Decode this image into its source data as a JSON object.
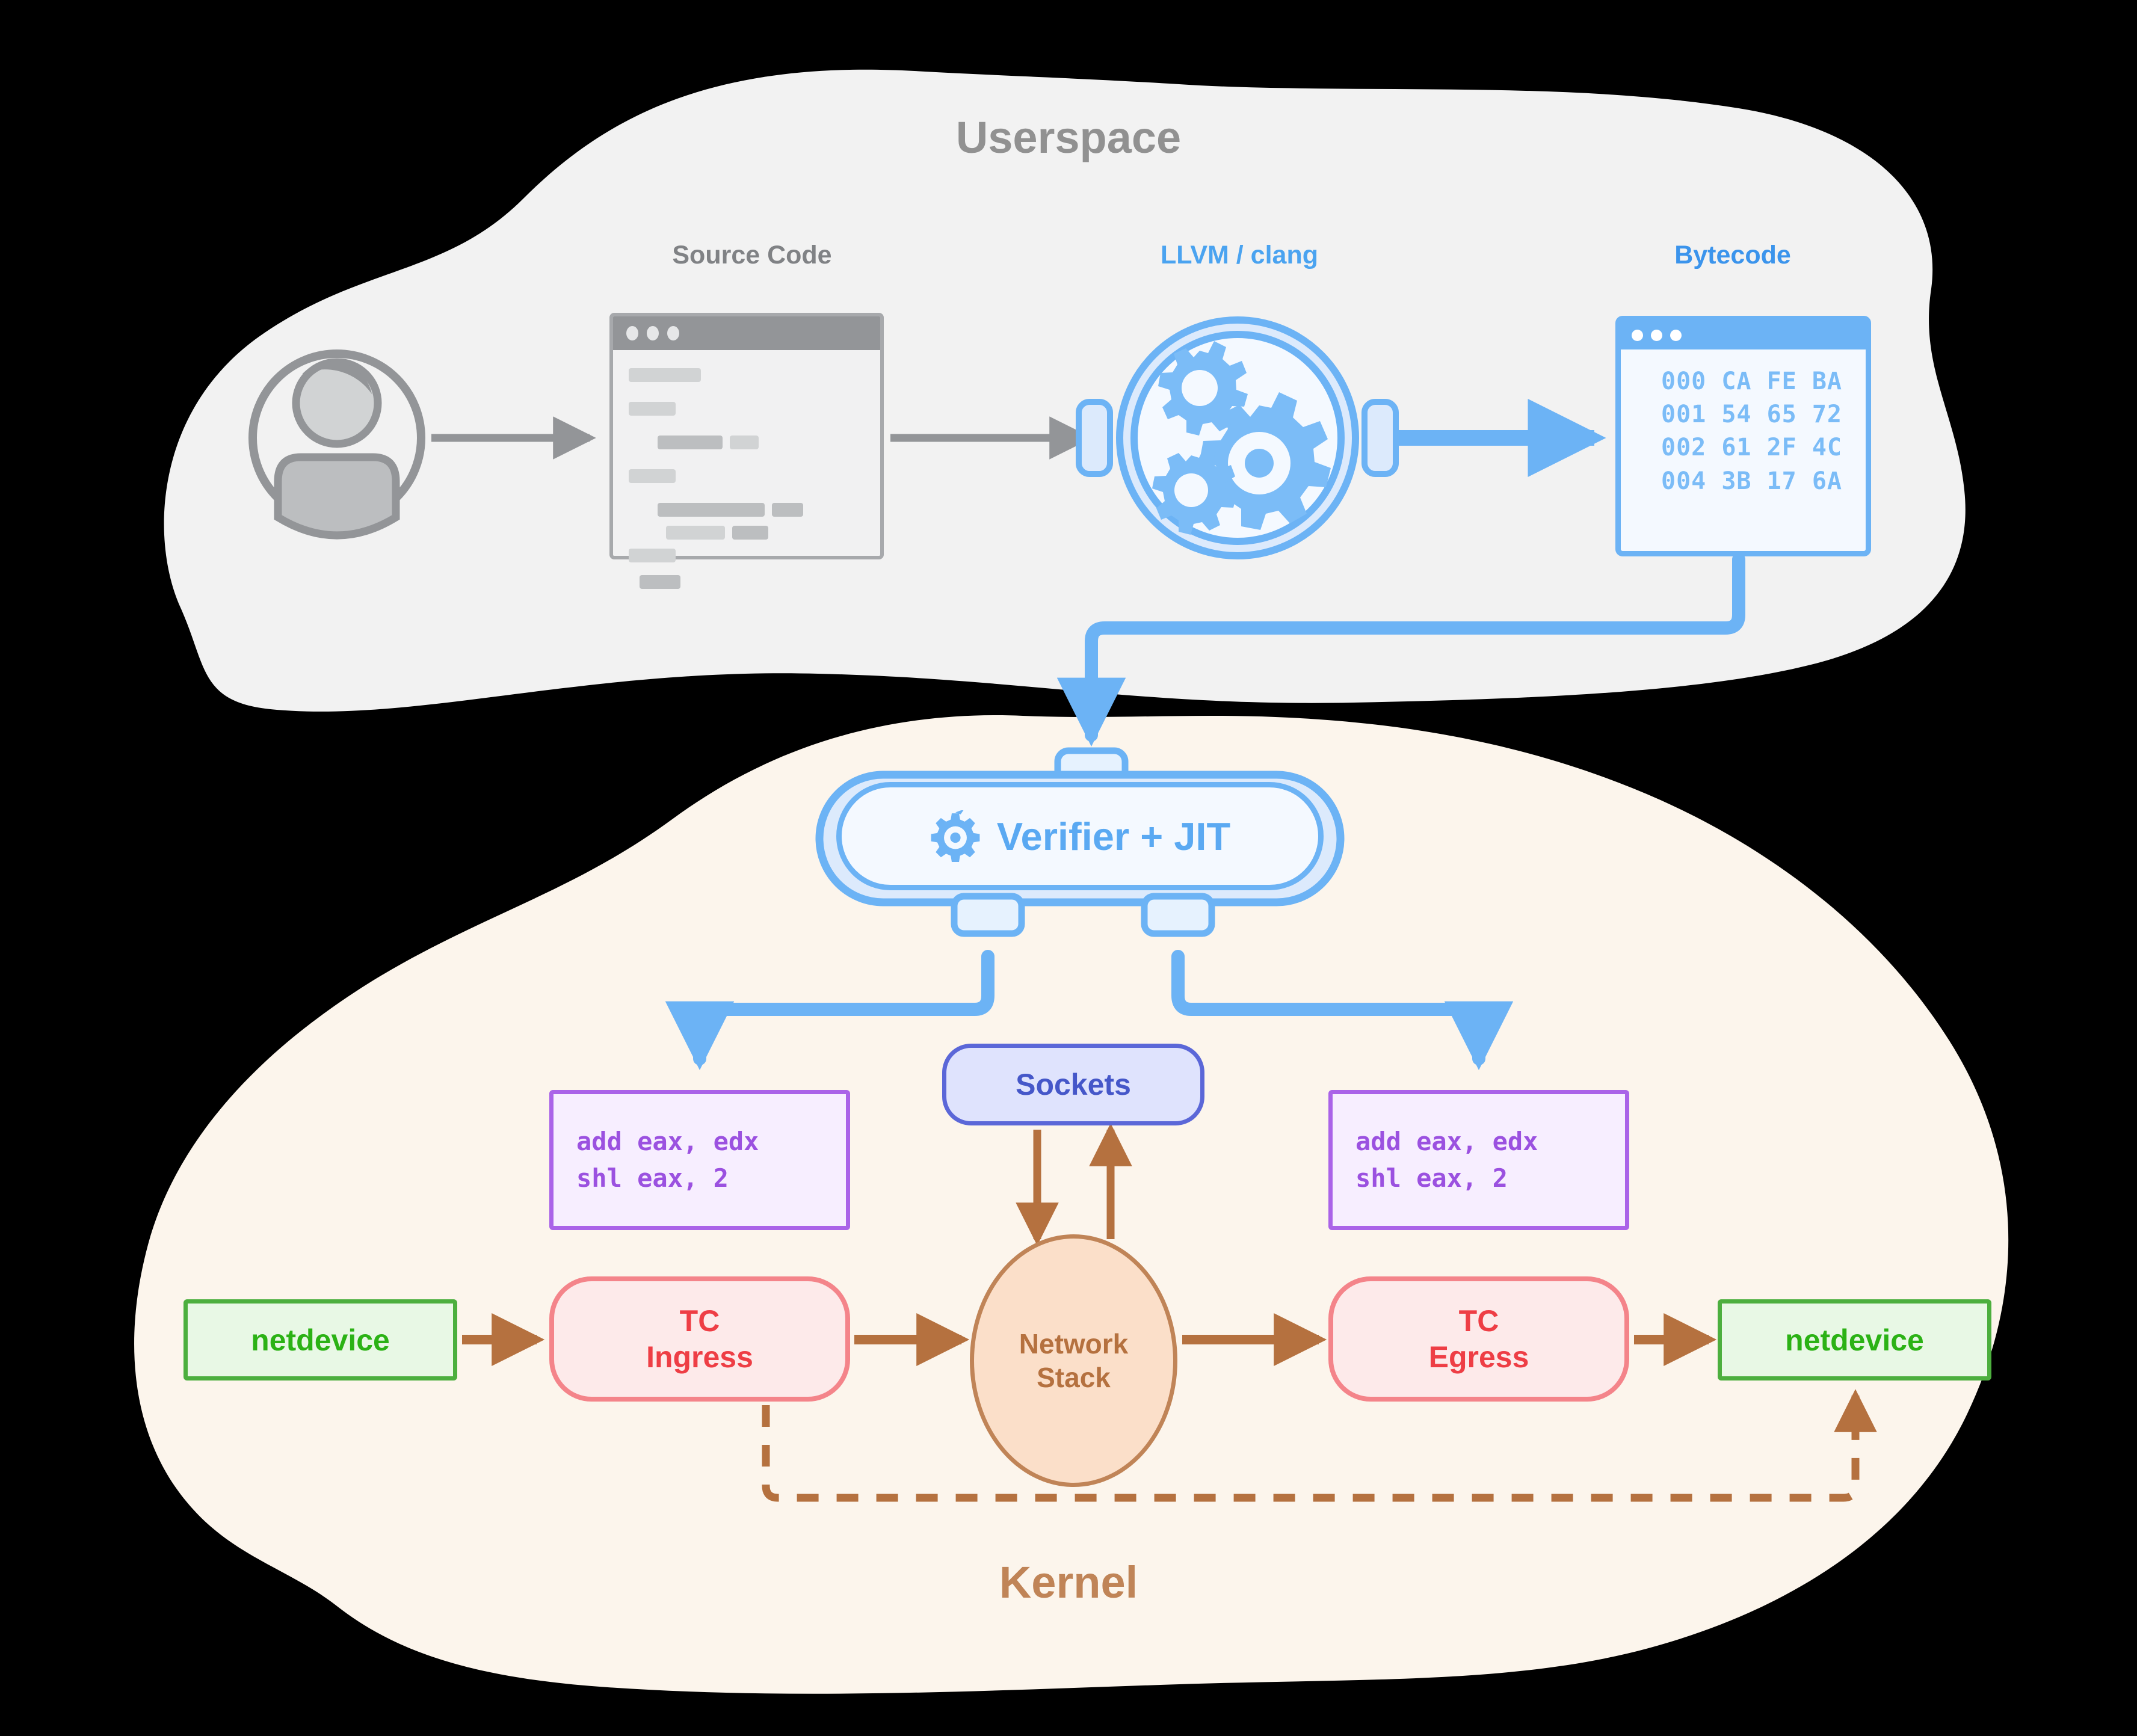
{
  "regions": {
    "userspace": {
      "title": "Userspace",
      "color": "#919191",
      "fill": "#f2f2f2"
    },
    "kernel": {
      "title": "Kernel",
      "color": "#c08457",
      "fill": "#fcf5ec"
    }
  },
  "userspace": {
    "actor": {
      "name": "user-avatar"
    },
    "source": {
      "caption": "Source Code",
      "window_icon": "window-dots-icon",
      "dots": 3
    },
    "compiler": {
      "caption": "LLVM / clang",
      "icon": "gears-icon"
    },
    "bytecode": {
      "caption": "Bytecode",
      "window_icon": "window-dots-icon",
      "dots": 3,
      "lines": [
        "000 CA FE BA",
        "001 54 65 72",
        "002 61 2F 4C",
        "004 3B 17 6A"
      ]
    }
  },
  "kernel": {
    "verifier": {
      "label": "Verifier + JIT",
      "icon": "gear-icon"
    },
    "asm_left": {
      "lines": [
        "add eax, edx",
        "shl eax, 2"
      ]
    },
    "asm_right": {
      "lines": [
        "add eax, edx",
        "shl eax, 2"
      ]
    },
    "sockets": {
      "label": "Sockets"
    },
    "network_stack": {
      "line1": "Network",
      "line2": "Stack"
    },
    "tc_ingress": {
      "line1": "TC",
      "line2": "Ingress"
    },
    "tc_egress": {
      "line1": "TC",
      "line2": "Egress"
    },
    "netdevice_left": {
      "label": "netdevice"
    },
    "netdevice_right": {
      "label": "netdevice"
    }
  },
  "colors": {
    "blue": "#6cb3f5",
    "blue_dark": "#3b94ec",
    "gray": "#939598",
    "purple": "#9b51e0",
    "indigo": "#4557c9",
    "brown": "#c08457",
    "red": "#ee3e45",
    "green": "#2bb215"
  }
}
